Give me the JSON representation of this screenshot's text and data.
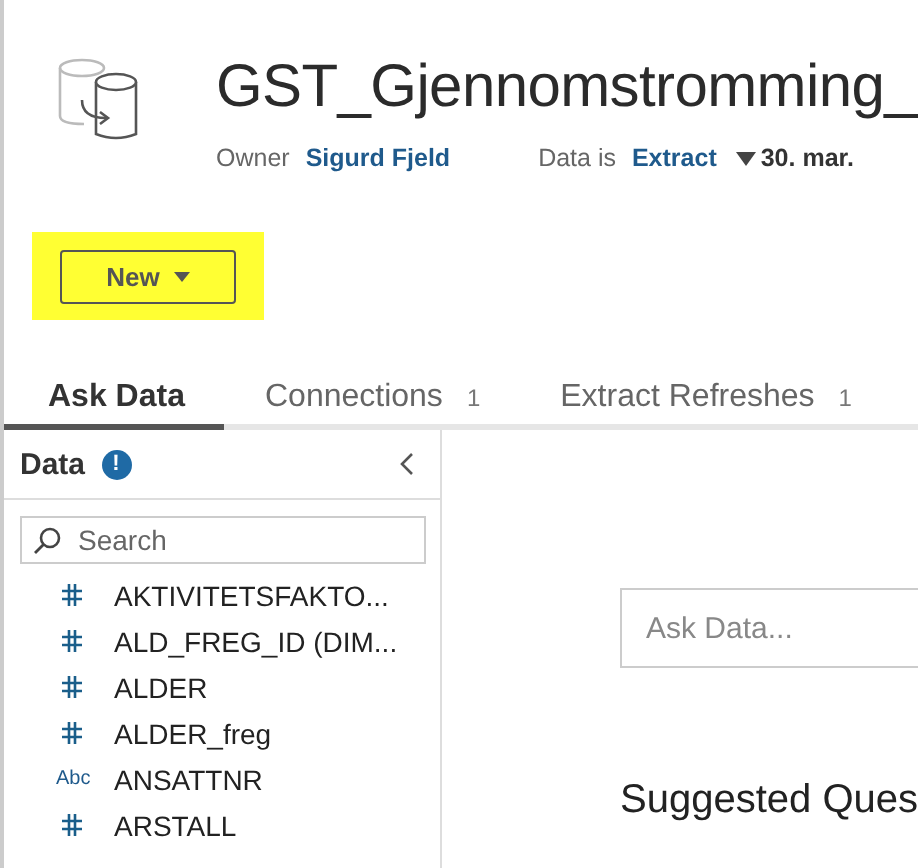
{
  "header": {
    "title": "GST_Gjennomstromming_",
    "owner_label": "Owner",
    "owner": "Sigurd Fjeld",
    "data_label": "Data is",
    "data_type": "Extract",
    "date": "30. mar."
  },
  "new_button": {
    "label": "New",
    "highlighted": true
  },
  "tabs": [
    {
      "label": "Ask Data",
      "selected": true
    },
    {
      "label": "Connections",
      "count": "1",
      "selected": false
    },
    {
      "label": "Extract Refreshes",
      "count": "1",
      "selected": false
    }
  ],
  "data_panel": {
    "title": "Data",
    "info": "!",
    "search_placeholder": "Search",
    "fields": [
      {
        "kind": "number",
        "name": "AKTIVITETSFAKTO..."
      },
      {
        "kind": "number",
        "name": "ALD_FREG_ID (DIM..."
      },
      {
        "kind": "number",
        "name": "ALDER"
      },
      {
        "kind": "number",
        "name": "ALDER_freg"
      },
      {
        "kind": "string",
        "type_label": "Abc",
        "name": "ANSATTNR"
      },
      {
        "kind": "number",
        "name": "ARSTALL"
      }
    ]
  },
  "ask": {
    "placeholder": "Ask Data...",
    "suggested_title": "Suggested Ques"
  }
}
